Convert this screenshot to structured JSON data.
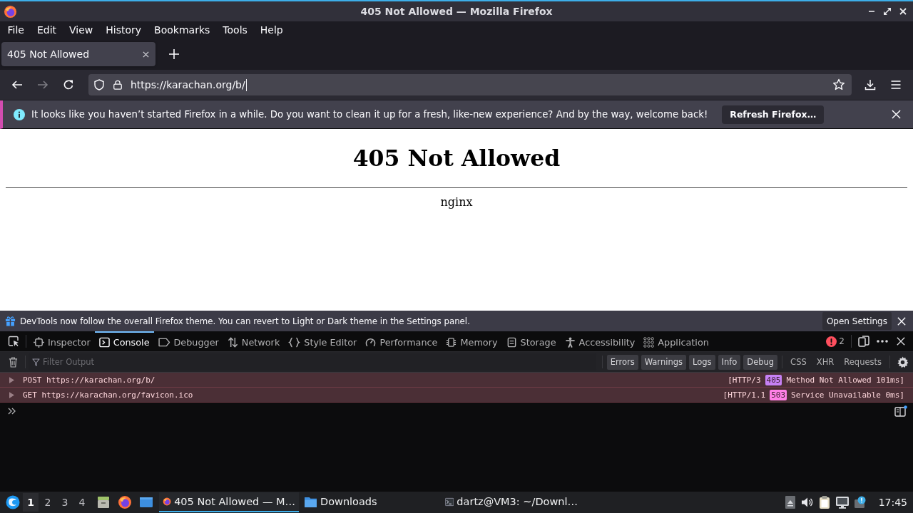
{
  "window": {
    "title": "405 Not Allowed — Mozilla Firefox"
  },
  "menu_bar": [
    "File",
    "Edit",
    "View",
    "History",
    "Bookmarks",
    "Tools",
    "Help"
  ],
  "tabs": [
    {
      "label": "405 Not Allowed",
      "selected": true
    }
  ],
  "nav_buttons": [
    {
      "kind": "back",
      "disabled": false
    },
    {
      "kind": "forward",
      "disabled": true
    },
    {
      "kind": "reload",
      "disabled": false
    }
  ],
  "url_bar": {
    "value": "https://karachan.org/b/",
    "focused": true
  },
  "notification": {
    "message": "It looks like you haven’t started Firefox in a while. Do you want to clean it up for a fresh, like-new experience? And by the way, welcome back!",
    "button": "Refresh Firefox…"
  },
  "page": {
    "heading": "405 Not Allowed",
    "server": "nginx"
  },
  "devtools": {
    "notice": {
      "message": "DevTools now follow the overall Firefox theme. You can revert to Light or Dark theme in the Settings panel.",
      "button": "Open Settings"
    },
    "tabs": [
      {
        "label": "Inspector",
        "selected": false
      },
      {
        "label": "Console",
        "selected": true
      },
      {
        "label": "Debugger",
        "selected": false
      },
      {
        "label": "Network",
        "selected": false
      },
      {
        "label": "Style Editor",
        "selected": false
      },
      {
        "label": "Performance",
        "selected": false
      },
      {
        "label": "Memory",
        "selected": false
      },
      {
        "label": "Storage",
        "selected": false
      },
      {
        "label": "Accessibility",
        "selected": false
      },
      {
        "label": "Application",
        "selected": false
      }
    ],
    "error_count": "2",
    "filter": {
      "placeholder": "Filter Output"
    },
    "level_filters": [
      {
        "label": "Errors",
        "selected": true
      },
      {
        "label": "Warnings",
        "selected": true
      },
      {
        "label": "Logs",
        "selected": true
      },
      {
        "label": "Info",
        "selected": true
      },
      {
        "label": "Debug",
        "selected": true
      }
    ],
    "request_filters": [
      {
        "label": "CSS",
        "selected": false
      },
      {
        "label": "XHR",
        "selected": false
      },
      {
        "label": "Requests",
        "selected": false
      }
    ],
    "messages": [
      {
        "method": "POST",
        "url": "https://karachan.org/b/",
        "protocol": "[HTTP/3",
        "status": "405",
        "status_text": "Method Not Allowed 101ms]",
        "color": "#c681f5",
        "expanded": false
      },
      {
        "method": "GET",
        "url": "https://karachan.org/favicon.ico",
        "protocol": "[HTTP/1.1",
        "status": "503",
        "status_text": "Service Unavailable 0ms]",
        "color": "#ff80e6",
        "expanded": false
      }
    ]
  },
  "taskbar": {
    "workspaces": [
      {
        "label": "1",
        "selected": true
      },
      {
        "label": "2",
        "selected": false
      },
      {
        "label": "3",
        "selected": false
      },
      {
        "label": "4",
        "selected": false
      }
    ],
    "tasks": [
      {
        "kind": "browser",
        "label": "405 Not Allowed — M…",
        "selected": true
      },
      {
        "kind": "folder",
        "label": "Downloads",
        "selected": false
      },
      {
        "kind": "terminal",
        "label": "dartz@VM3: ~/Downl…",
        "selected": false
      }
    ],
    "clock": "17:45"
  }
}
